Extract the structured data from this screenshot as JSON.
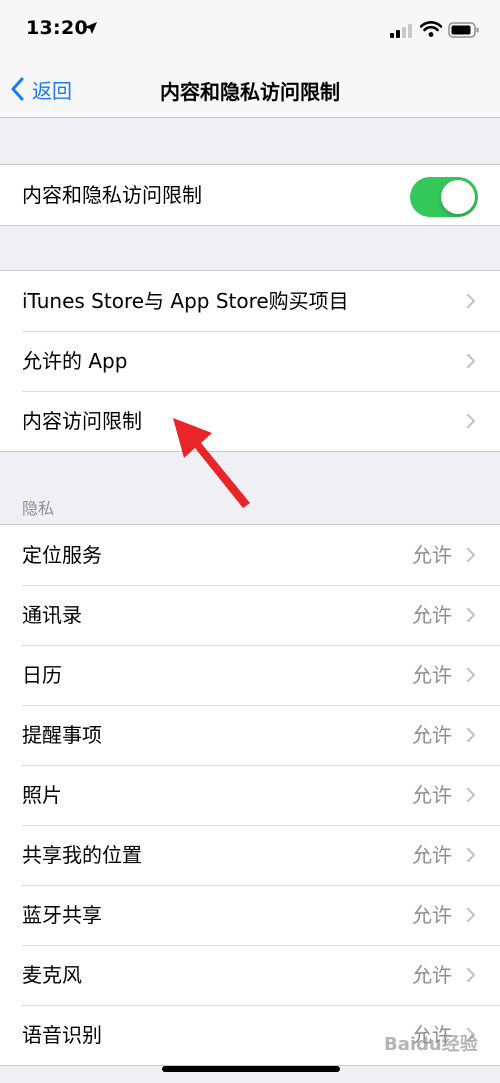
{
  "status_bar": {
    "time": "13:20"
  },
  "nav": {
    "back_label": "返回",
    "title": "内容和隐私访问限制"
  },
  "toggle_group": {
    "label": "内容和隐私访问限制",
    "enabled": true,
    "on_color": "#34c759"
  },
  "menu_group": {
    "items": [
      {
        "label": "iTunes Store与 App Store购买项目"
      },
      {
        "label": "允许的 App"
      },
      {
        "label": "内容访问限制"
      }
    ]
  },
  "privacy": {
    "header": "隐私",
    "items": [
      {
        "label": "定位服务",
        "value": "允许"
      },
      {
        "label": "通讯录",
        "value": "允许"
      },
      {
        "label": "日历",
        "value": "允许"
      },
      {
        "label": "提醒事项",
        "value": "允许"
      },
      {
        "label": "照片",
        "value": "允许"
      },
      {
        "label": "共享我的位置",
        "value": "允许"
      },
      {
        "label": "蓝牙共享",
        "value": "允许"
      },
      {
        "label": "麦克风",
        "value": "允许"
      },
      {
        "label": "语音识别",
        "value": "允许"
      }
    ]
  },
  "colors": {
    "accent": "#1a7cf5",
    "annotation": "#e8262a"
  },
  "watermark": "Baidu经验"
}
